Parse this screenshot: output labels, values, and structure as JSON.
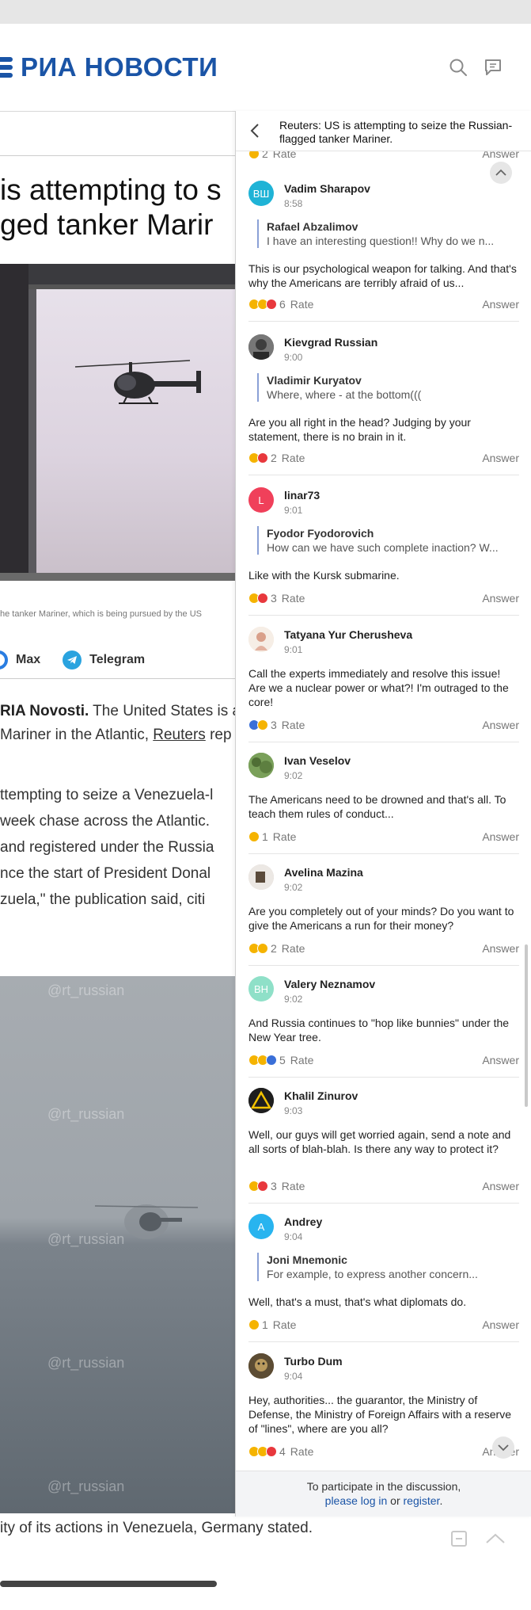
{
  "header": {
    "logo_text": "РИА НОВОСТИ",
    "brand_color": "#1a54a6",
    "search_icon": "search-icon",
    "chat_icon": "comments-icon"
  },
  "article": {
    "title_line1": "is attempting to s",
    "title_line2": "ged tanker Marir",
    "caption": "he tanker Mariner, which is being pursued by the US",
    "share": {
      "max_label": "Max",
      "telegram_label": "Telegram"
    },
    "lead_bold": "RIA Novosti.",
    "lead_rest": " The United States is at",
    "lead_line2_pre": " Mariner in the Atlantic, ",
    "lead_link": "Reuters",
    "lead_line2_post": " rep",
    "para": [
      "ttempting to seize a Venezuela-l",
      "week chase across the Atlantic.",
      "and registered under the Russia",
      "nce the start of President Donal",
      "zuela,\" the publication said, citi"
    ],
    "watermark": "@rt_russian",
    "bottom_text": "ity of its actions in Venezuela, Germany stated."
  },
  "panel": {
    "title": "Reuters: US is attempting to seize the Russian-flagged tanker Mariner.",
    "partial_top": {
      "count": "2",
      "rate": "Rate",
      "answer": "Answer"
    },
    "footer_text": "To participate in the discussion,",
    "footer_login": "please log in",
    "footer_or": " or ",
    "footer_register": "register",
    "footer_end": "."
  },
  "comments": [
    {
      "name": "Vadim Sharapov",
      "time": "8:58",
      "avatar": "ВШ",
      "avatar_color": "#1fb3d6",
      "quote_name": "Rafael Abzalimov",
      "quote_text": "I have an interesting question!! Why do we n...",
      "text": "This is our psychological weapon for talking. And that's why the Americans are terribly afraid of us...",
      "count": "6",
      "rate": "Rate",
      "answer": "Answer",
      "emojis": [
        "#f5b300",
        "#f5b300",
        "#e8383d"
      ]
    },
    {
      "name": "Kievgrad Russian",
      "time": "9:00",
      "avatar": "",
      "avatar_color": "#555555",
      "quote_name": "Vladimir Kuryatov",
      "quote_text": "Where, where - at the bottom(((",
      "text": "Are you all right in the head? Judging by your statement, there is no brain in it.",
      "count": "2",
      "rate": "Rate",
      "answer": "Answer",
      "emojis": [
        "#f5b300",
        "#e8383d"
      ]
    },
    {
      "name": "linar73",
      "time": "9:01",
      "avatar": "L",
      "avatar_color": "#f0405a",
      "quote_name": "Fyodor Fyodorovich",
      "quote_text": "How can we have such complete inaction? W...",
      "text": "Like with the Kursk submarine.",
      "count": "3",
      "rate": "Rate",
      "answer": "Answer",
      "emojis": [
        "#f5b300",
        "#e8383d"
      ]
    },
    {
      "name": "Tatyana Yur Cherusheva",
      "time": "9:01",
      "avatar": "",
      "avatar_color": "#f3e3d3",
      "quote_name": "",
      "quote_text": "",
      "text": "Call the experts immediately and resolve this issue! Are we a nuclear power or what?! I'm outraged to the core!",
      "count": "3",
      "rate": "Rate",
      "answer": "Answer",
      "emojis": [
        "#3a6fd8",
        "#f5b300"
      ]
    },
    {
      "name": "Ivan Veselov",
      "time": "9:02",
      "avatar": "",
      "avatar_color": "#6c8f4a",
      "quote_name": "",
      "quote_text": "",
      "text": "The Americans need to be drowned and that's all. To teach them rules of conduct...",
      "count": "1",
      "rate": "Rate",
      "answer": "Answer",
      "emojis": [
        "#f5b300"
      ]
    },
    {
      "name": "Avelina Mazina",
      "time": "9:02",
      "avatar": "",
      "avatar_color": "#d8d0c8",
      "quote_name": "",
      "quote_text": "",
      "text": "Are you completely out of your minds? Do you want to give the Americans a run for their money?",
      "count": "2",
      "rate": "Rate",
      "answer": "Answer",
      "emojis": [
        "#f5b300",
        "#f5b300"
      ]
    },
    {
      "name": "Valery Neznamov",
      "time": "9:02",
      "avatar": "ВН",
      "avatar_color": "#8fe0c8",
      "quote_name": "",
      "quote_text": "",
      "text": "And Russia continues to \"hop like bunnies\" under the New Year tree.",
      "count": "5",
      "rate": "Rate",
      "answer": "Answer",
      "emojis": [
        "#f5b300",
        "#f5b300",
        "#3a6fd8"
      ]
    },
    {
      "name": "Khalil Zinurov",
      "time": "9:03",
      "avatar": "",
      "avatar_color": "#2a2a2a",
      "quote_name": "",
      "quote_text": "",
      "text": "Well, our guys will get worried again, send a note and all sorts of blah-blah. Is there any way to protect it?",
      "count": "3",
      "rate": "Rate",
      "answer": "Answer",
      "emojis": [
        "#f5b300",
        "#e8383d"
      ]
    },
    {
      "name": "Andrey",
      "time": "9:04",
      "avatar": "A",
      "avatar_color": "#28b4ef",
      "quote_name": "Joni Mnemonic",
      "quote_text": "For example, to express another concern...",
      "text": "Well, that's a must, that's what diplomats do.",
      "count": "1",
      "rate": "Rate",
      "answer": "Answer",
      "emojis": [
        "#f5b300"
      ]
    },
    {
      "name": "Turbo Dum",
      "time": "9:04",
      "avatar": "",
      "avatar_color": "#6d5a3a",
      "quote_name": "",
      "quote_text": "",
      "text": "Hey, authorities... the guarantor, the Ministry of Defense, the Ministry of Foreign Affairs with a reserve of \"lines\", where are you all?",
      "count": "4",
      "rate": "Rate",
      "answer": "Answer",
      "emojis": [
        "#f5b300",
        "#f5b300",
        "#e8383d"
      ]
    }
  ]
}
